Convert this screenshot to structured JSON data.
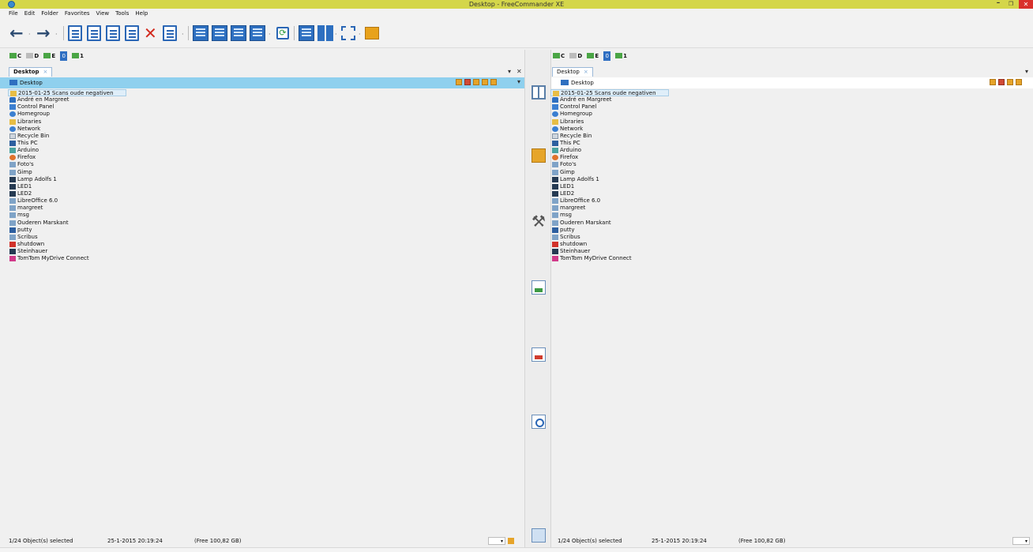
{
  "window": {
    "title": "Desktop - FreeCommander XE",
    "minimize": "–",
    "maximize": "❐",
    "close": "✕"
  },
  "menu": [
    "File",
    "Edit",
    "Folder",
    "Favorites",
    "View",
    "Tools",
    "Help"
  ],
  "toolbar": {
    "back": "←",
    "forward": "→",
    "dropdown": "·",
    "delete": "✕",
    "refresh": "⟳"
  },
  "left": {
    "drives": [
      "C",
      "D",
      "E",
      "0",
      "1"
    ],
    "tab": "Desktop",
    "tab_close": "×",
    "tab_menu": "▾",
    "tab_x": "✕",
    "path": "Desktop",
    "path_dd": "▾",
    "files": [
      "2015-01-25 Scans oude negativen",
      "André en Margreet",
      "Control Panel",
      "Homegroup",
      "Libraries",
      "Network",
      "Recycle Bin",
      "This PC",
      "Arduino",
      "Firefox",
      "Foto's",
      "Gimp",
      "Lamp Adolfs 1",
      "LED1",
      "LED2",
      "LibreOffice 6.0",
      "margreet",
      "msg",
      "Ouderen Marskant",
      "putty",
      "Scribus",
      "shutdown",
      "Steinhauer",
      "TomTom MyDrive Connect"
    ],
    "status": {
      "selected": "1/24 Object(s) selected",
      "date": "25-1-2015 20:19:24",
      "free": "(Free 100,82 GB)",
      "dd": "▾"
    }
  },
  "right": {
    "drives": [
      "C",
      "D",
      "E",
      "0",
      "1"
    ],
    "tab": "Desktop",
    "tab_close": "×",
    "tab_menu": "▾",
    "path": "Desktop",
    "files": [
      "2015-01-25 Scans oude negativen",
      "André en Margreet",
      "Control Panel",
      "Homegroup",
      "Libraries",
      "Network",
      "Recycle Bin",
      "This PC",
      "Arduino",
      "Firefox",
      "Foto's",
      "Gimp",
      "Lamp Adolfs 1",
      "LED1",
      "LED2",
      "LibreOffice 6.0",
      "margreet",
      "msg",
      "Ouderen Marskant",
      "putty",
      "Scribus",
      "shutdown",
      "Steinhauer",
      "TomTom MyDrive Connect"
    ],
    "status": {
      "selected": "1/24 Object(s) selected",
      "date": "25-1-2015 20:19:24",
      "free": "(Free 100,82 GB)",
      "dd": "▾"
    }
  },
  "middle": {
    "tools": "⚒"
  },
  "colors": {
    "title_bar": "#d4d64a",
    "path_bar": "#8fd0ee",
    "close_button": "#d9302c",
    "selection": "#dfeef9"
  }
}
